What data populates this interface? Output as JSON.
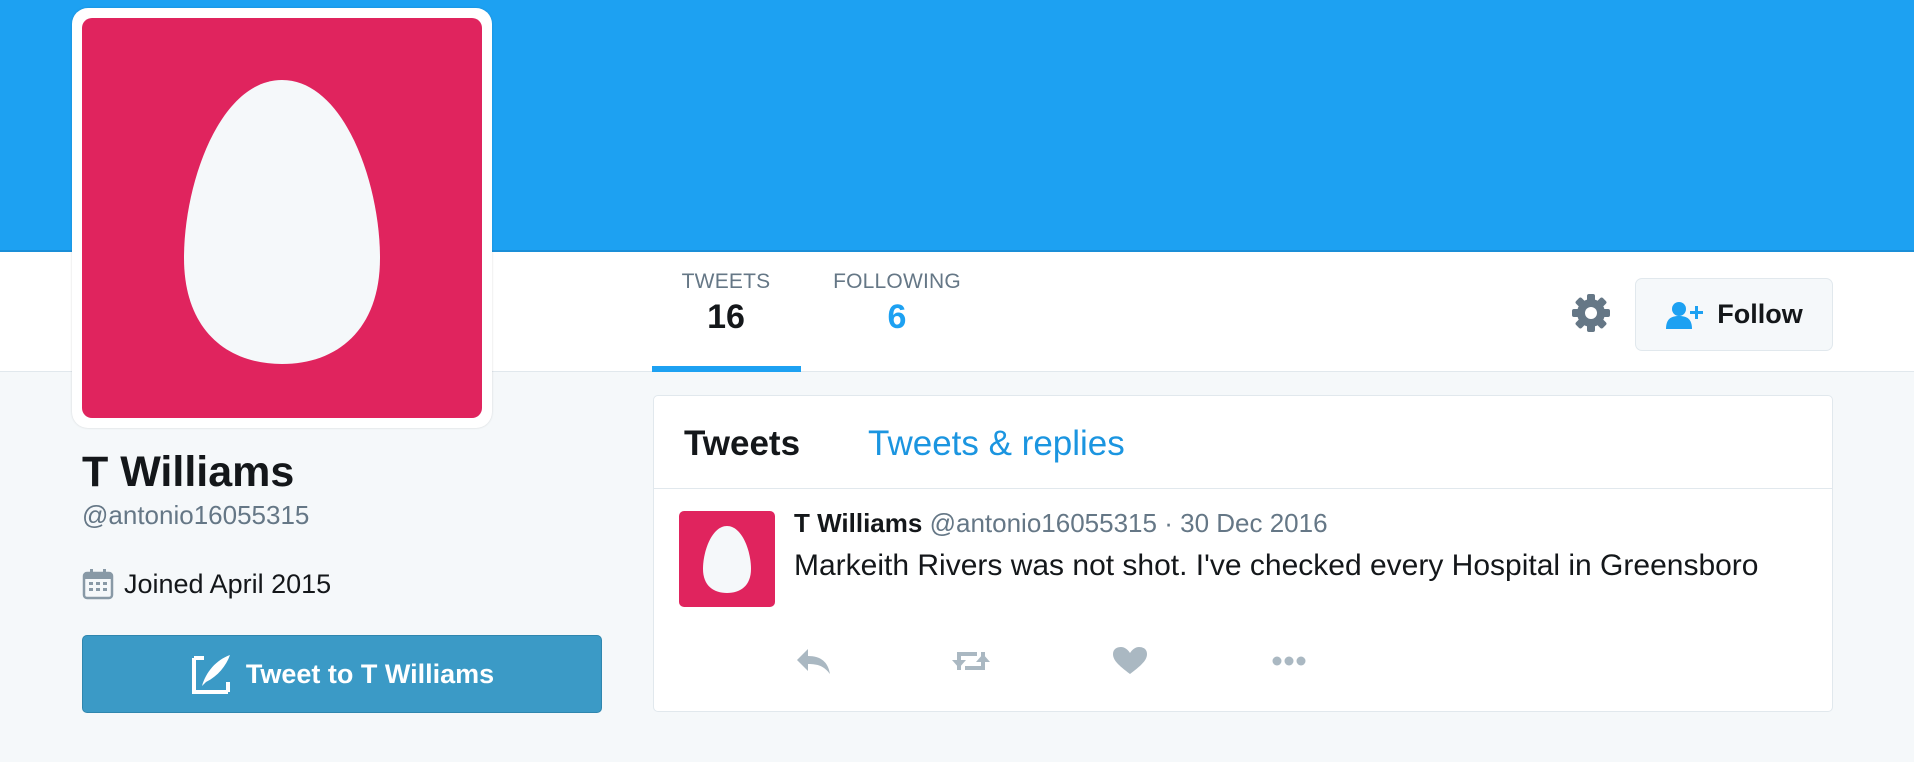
{
  "profile": {
    "name": "T Williams",
    "handle": "@antonio16055315",
    "joined": "Joined April 2015",
    "tweet_to_label": "Tweet to T Williams",
    "avatar_color": "#e0245e",
    "banner_color": "#1da1f2"
  },
  "nav": {
    "stats": [
      {
        "label": "TWEETS",
        "value": "16"
      },
      {
        "label": "FOLLOWING",
        "value": "6"
      }
    ],
    "follow_label": "Follow",
    "settings_icon": "gear-icon"
  },
  "timeline": {
    "tabs": [
      "Tweets",
      "Tweets & replies"
    ],
    "tweets": [
      {
        "name": "T Williams",
        "handle": "@antonio16055315",
        "separator": "·",
        "date": "30 Dec 2016",
        "text": "Markeith Rivers was not shot. I've checked every Hospital in Greensboro",
        "actions": [
          "reply-icon",
          "retweet-icon",
          "like-icon",
          "more-icon"
        ]
      }
    ]
  }
}
